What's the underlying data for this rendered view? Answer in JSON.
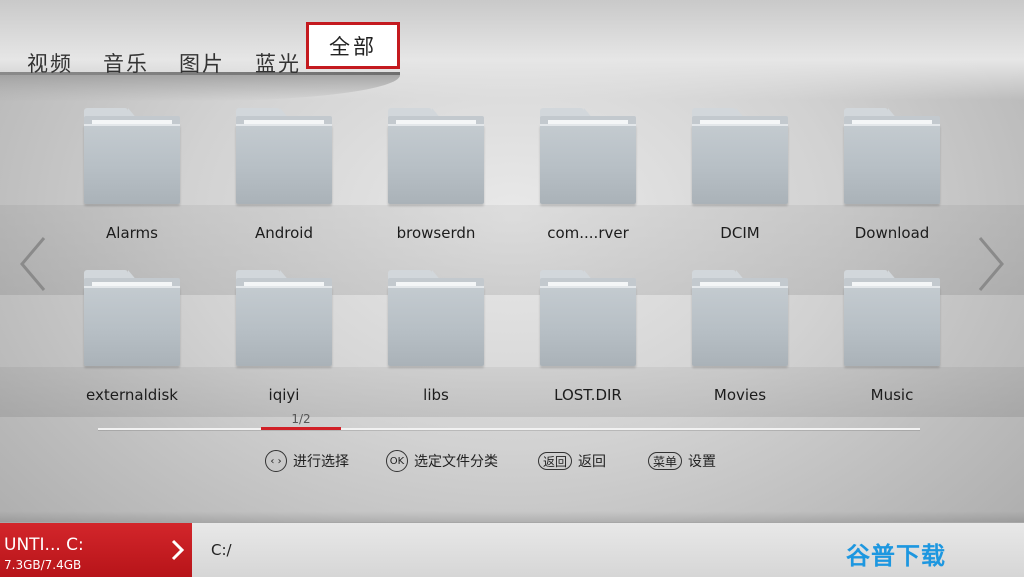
{
  "tabs": [
    {
      "label": "视频"
    },
    {
      "label": "音乐"
    },
    {
      "label": "图片"
    },
    {
      "label": "蓝光"
    }
  ],
  "active_tab": {
    "label": "全部"
  },
  "folders": [
    {
      "name": "Alarms"
    },
    {
      "name": "Android"
    },
    {
      "name": "browserdn"
    },
    {
      "name": "com....rver"
    },
    {
      "name": "DCIM"
    },
    {
      "name": "Download"
    },
    {
      "name": "externaldisk"
    },
    {
      "name": "iqiyi"
    },
    {
      "name": "libs"
    },
    {
      "name": "LOST.DIR"
    },
    {
      "name": "Movies"
    },
    {
      "name": "Music"
    }
  ],
  "pager": {
    "text": "1/2",
    "current": 1,
    "total": 2
  },
  "hints": [
    {
      "key": "‹ ›",
      "text": "进行选择",
      "icon": "left-right-arrows-icon"
    },
    {
      "key": "OK",
      "text": "选定文件分类",
      "icon": "ok-button-icon"
    },
    {
      "key": "返回",
      "text": "返回",
      "icon": "back-key-icon"
    },
    {
      "key": "菜单",
      "text": "设置",
      "icon": "menu-key-icon"
    }
  ],
  "drive": {
    "name": "UNTI...  C:",
    "size": "7.3GB/7.4GB"
  },
  "path": "C:/",
  "watermark": "谷普下载",
  "colors": {
    "accent": "#c41a1f",
    "watermark": "#1d97e0"
  }
}
